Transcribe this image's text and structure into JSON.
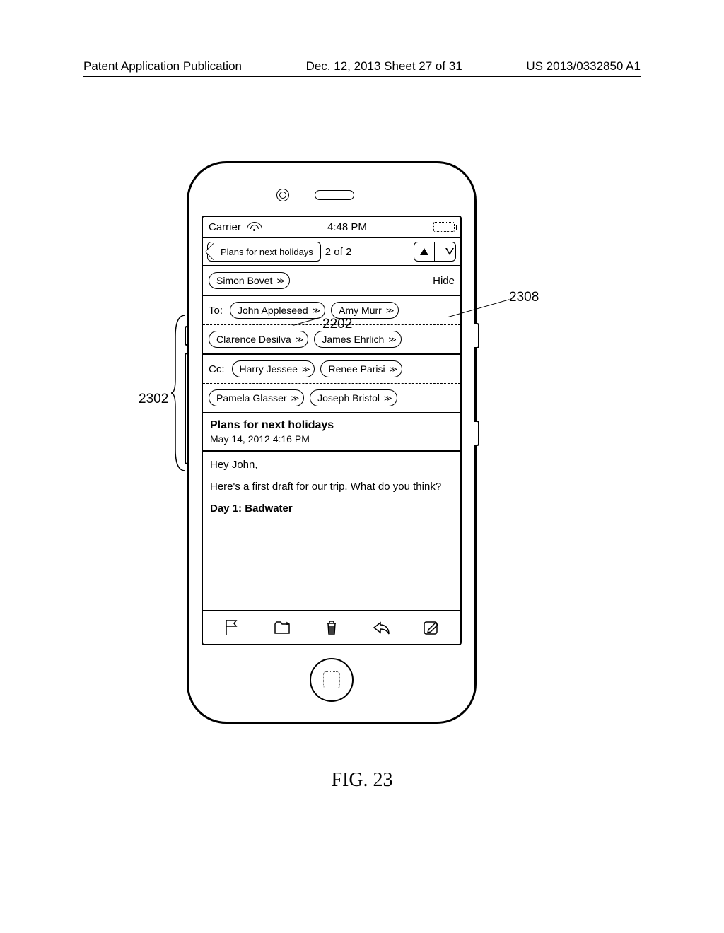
{
  "header": {
    "left": "Patent Application Publication",
    "center": "Dec. 12, 2013  Sheet 27 of 31",
    "right": "US 2013/0332850 A1"
  },
  "statusbar": {
    "carrier": "Carrier",
    "time": "4:48 PM"
  },
  "nav": {
    "back": "Plans for next holidays",
    "count": "2 of 2"
  },
  "sender": {
    "pill": "Simon Bovet",
    "hide": "Hide"
  },
  "to": {
    "label": "To:",
    "row1": [
      "John Appleseed",
      "Amy Murr"
    ],
    "row2": [
      "Clarence Desilva",
      "James Ehrlich"
    ]
  },
  "cc": {
    "label": "Cc:",
    "row1": [
      "Harry Jessee",
      "Renee Parisi"
    ],
    "row2": [
      "Pamela Glasser",
      "Joseph Bristol"
    ]
  },
  "subject": {
    "title": "Plans for next holidays",
    "date": "May 14, 2012 4:16 PM"
  },
  "body": {
    "greeting": "Hey John,",
    "p1": "Here's a first draft for our trip. What do you think?",
    "day1": "Day 1: Badwater"
  },
  "anno": {
    "a2302": "2302",
    "a2202": "2202",
    "a2308": "2308"
  },
  "figure": "FIG. 23"
}
